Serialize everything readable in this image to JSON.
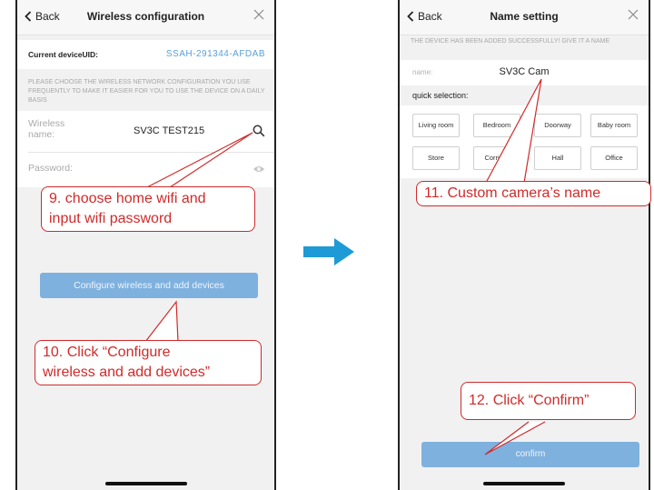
{
  "left_screen": {
    "back_label": "Back",
    "title": "Wireless configuration",
    "uid_label": "Current deviceUID:",
    "uid_value": "SSAH-291344-AFDAB",
    "hint": "PLEASE CHOOSE THE WIRELESS NETWORK CONFIGURATION YOU USE FREQUENTLY TO MAKE IT EASIER FOR YOU TO USE THE DEVICE ON A DAILY BASIS",
    "wireless_label_line1": "Wireless",
    "wireless_label_line2": "name:",
    "wireless_value": "SV3C TEST215",
    "password_label": "Password:",
    "configure_button": "Configure wireless and add devices"
  },
  "right_screen": {
    "back_label": "Back",
    "title": "Name setting",
    "added_message": "THE DEVICE HAS BEEN ADDED SUCCESSFULLY! GIVE IT A NAME",
    "name_label": "name:",
    "name_value": "SV3C Cam",
    "quick_selection_label": "quick selection:",
    "chips": [
      "Living room",
      "Bedroom",
      "Doorway",
      "Baby room",
      "Store",
      "Corridor",
      "Hall",
      "Office"
    ],
    "confirm_button": "confirm"
  },
  "callouts": {
    "step9_line1": "9. choose home wifi and",
    "step9_line2": "input wifi password",
    "step10_line1": "10. Click “Configure",
    "step10_line2": "wireless and add devices”",
    "step11": "11. Custom camera’s name",
    "step12": "12. Click “Confirm”"
  },
  "colors": {
    "accent_blue": "#7fb1de",
    "uid_blue": "#5aa0d8",
    "callout_red": "#d12a2a",
    "arrow_blue": "#1e9ad6"
  }
}
